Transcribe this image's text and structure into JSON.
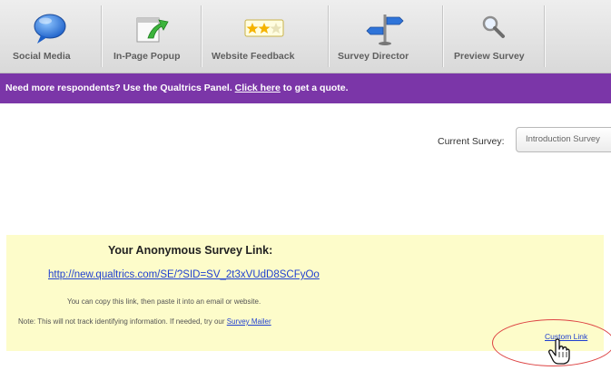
{
  "toolbar": {
    "items": [
      {
        "label": "Social Media",
        "icon": "speech-bubble-icon"
      },
      {
        "label": "In-Page Popup",
        "icon": "popup-arrow-icon"
      },
      {
        "label": "Website Feedback",
        "icon": "stars-icon"
      },
      {
        "label": "Survey Director",
        "icon": "signpost-icon"
      },
      {
        "label": "Preview Survey",
        "icon": "magnifier-icon"
      }
    ]
  },
  "banner": {
    "text_before": "Need more respondents? Use the Qualtrics Panel. ",
    "link_text": "Click here",
    "text_after": " to get a quote."
  },
  "current_survey": {
    "label": "Current Survey:",
    "value": "Introduction Survey"
  },
  "survey_link": {
    "title": "Your Anonymous Survey Link:",
    "url": "http://new.qualtrics.com/SE/?SID=SV_2t3xVUdD8SCFyOo",
    "copy_note": "You can copy this link, then paste it into an email or website.",
    "track_note_prefix": "Note: This will not track identifying information. If needed, try our ",
    "track_note_link": "Survey Mailer",
    "custom_link": "Custom Link"
  },
  "colors": {
    "banner": "#7b36a8",
    "panel": "#fdfcca",
    "link": "#1f3fd0",
    "highlight_ellipse": "#dd4444"
  }
}
